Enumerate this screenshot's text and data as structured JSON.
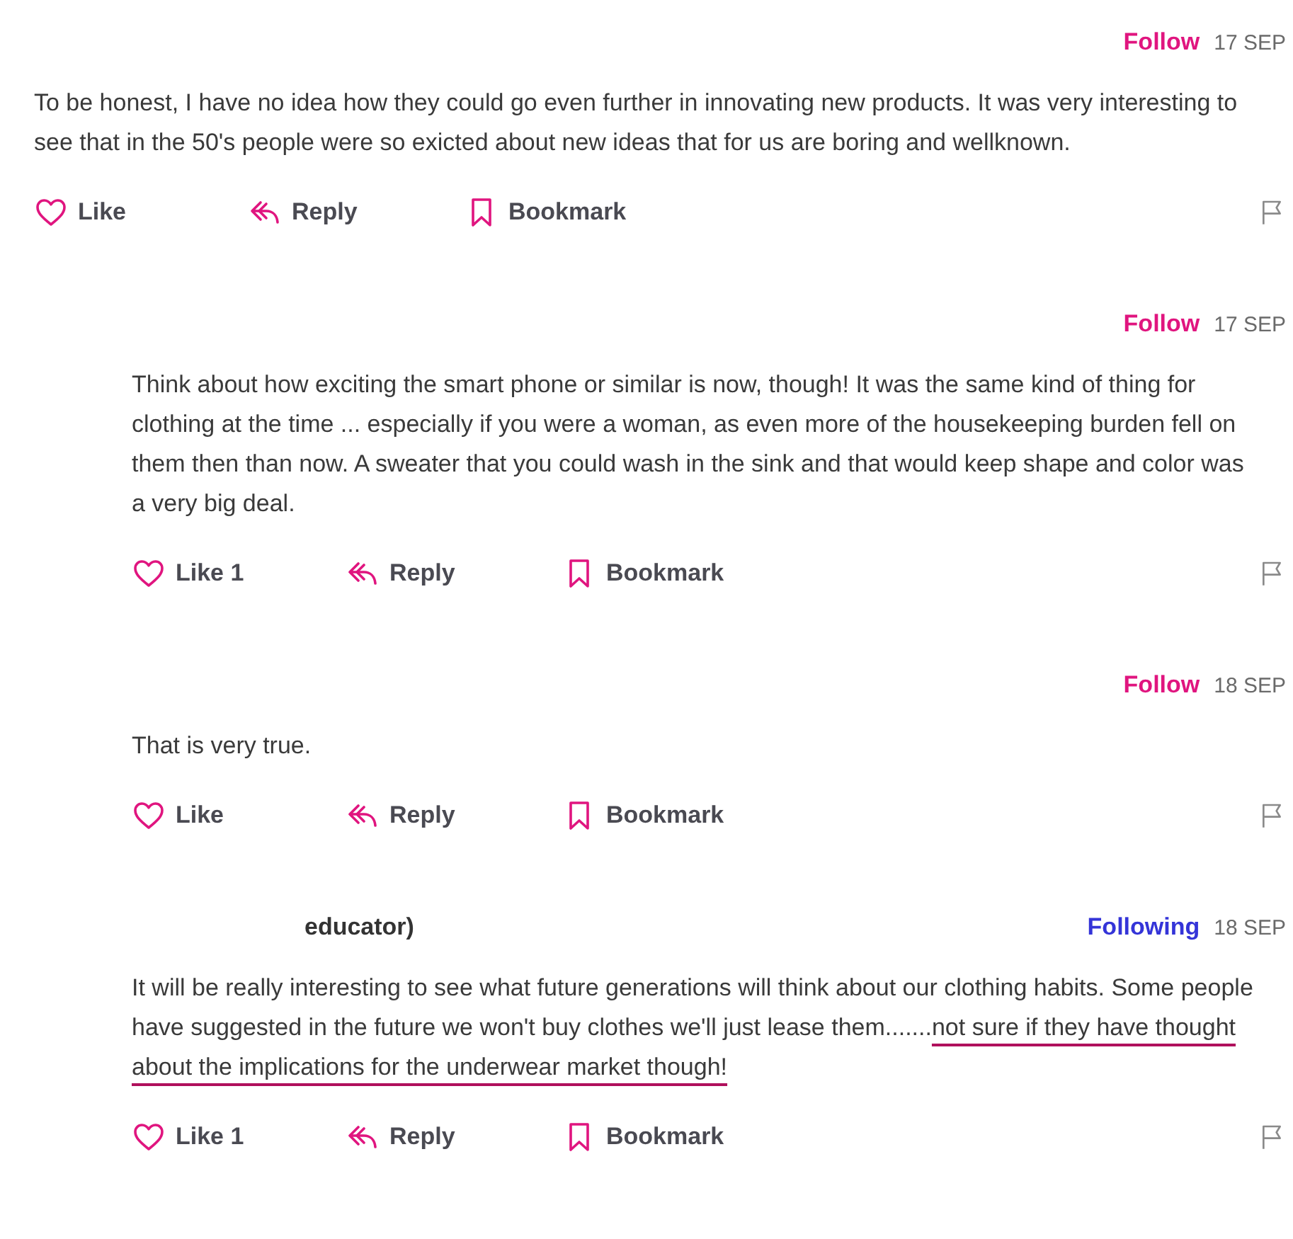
{
  "comments": [
    {
      "following": false,
      "follow_label": "Follow",
      "date": "17 SEP",
      "body": "To be honest, I have no idea how they could go even further in innovating new products. It was very interesting to see that in the 50's people were so exicted about new ideas that for us are boring and wellknown.",
      "actions": {
        "like": "Like",
        "reply": "Reply",
        "bookmark": "Bookmark"
      },
      "replies": [
        {
          "following": false,
          "follow_label": "Follow",
          "date": "17 SEP",
          "body": "Think about how exciting the smart phone or similar is now, though! It was the same kind of thing for clothing at the time ... especially if you were a woman, as even more of the housekeeping burden fell on them then than now. A sweater that you could wash in the sink and that would keep shape and color was a very big deal.",
          "actions": {
            "like": "Like",
            "like_count": "1",
            "reply": "Reply",
            "bookmark": "Bookmark"
          }
        },
        {
          "following": false,
          "follow_label": "Follow",
          "date": "18 SEP",
          "body": "That is very true.",
          "actions": {
            "like": "Like",
            "reply": "Reply",
            "bookmark": "Bookmark"
          }
        },
        {
          "author": "educator)",
          "following": true,
          "follow_label": "Following",
          "date": "18 SEP",
          "body": "It will be really interesting to see what future generations will think about our clothing habits. Some people have suggested in the future we won't buy clothes we'll just lease them.......",
          "underlined": "not sure if they have thought about the implications for the underwear market though!",
          "actions": {
            "like": "Like",
            "like_count": "1",
            "reply": "Reply",
            "bookmark": "Bookmark"
          }
        }
      ]
    }
  ]
}
